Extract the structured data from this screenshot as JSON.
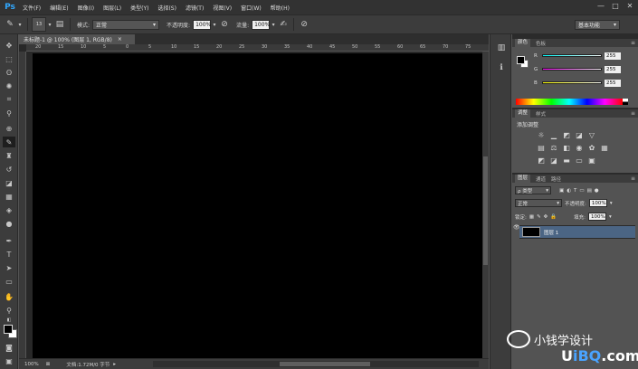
{
  "app": {
    "logo": "Ps"
  },
  "menu": [
    "文件(F)",
    "编辑(E)",
    "图像(I)",
    "图层(L)",
    "类型(Y)",
    "选择(S)",
    "滤镜(T)",
    "视图(V)",
    "窗口(W)",
    "帮助(H)"
  ],
  "window_controls": [
    "—",
    "□",
    "✕"
  ],
  "options": {
    "brush_size": "13",
    "mode_label": "模式:",
    "mode_value": "正常",
    "opacity_label": "不透明度:",
    "opacity_value": "100%",
    "flow_label": "流量:",
    "flow_value": "100%",
    "workspace": "基本功能"
  },
  "document": {
    "tab_title": "未标题-1 @ 100% (图层 1, RGB/8)",
    "tab_close": "×",
    "ruler_top": [
      "20",
      "15",
      "10",
      "5",
      "0",
      "5",
      "10",
      "15",
      "20",
      "25",
      "30",
      "35",
      "40",
      "45",
      "50",
      "55",
      "60",
      "65",
      "70",
      "75"
    ],
    "status_zoom": "100%",
    "status_doc": "文档:1.72M/0 字节"
  },
  "color_panel": {
    "tabs": [
      "颜色",
      "色板"
    ],
    "r_label": "R",
    "r_value": "255",
    "g_label": "G",
    "g_value": "255",
    "b_label": "B",
    "b_value": "255"
  },
  "adjust_panel": {
    "tabs": [
      "调整",
      "样式"
    ],
    "title": "添加调整"
  },
  "layers_panel": {
    "tabs": [
      "图层",
      "通道",
      "路径"
    ],
    "kind_filter": "ρ 类型",
    "blend_mode": "正常",
    "opacity_label": "不透明度:",
    "opacity_value": "100%",
    "lock_label": "锁定:",
    "fill_label": "填充:",
    "fill_value": "100%",
    "layer_name": "图层 1"
  },
  "watermark": {
    "wechat_text": "小钱学设计",
    "site_prefix": "U",
    "site_blue": "iBQ",
    "site_suffix": ".com"
  },
  "colors": {
    "foreground": "#000000",
    "background": "#ffffff",
    "layer_selected": "#4b6584"
  }
}
